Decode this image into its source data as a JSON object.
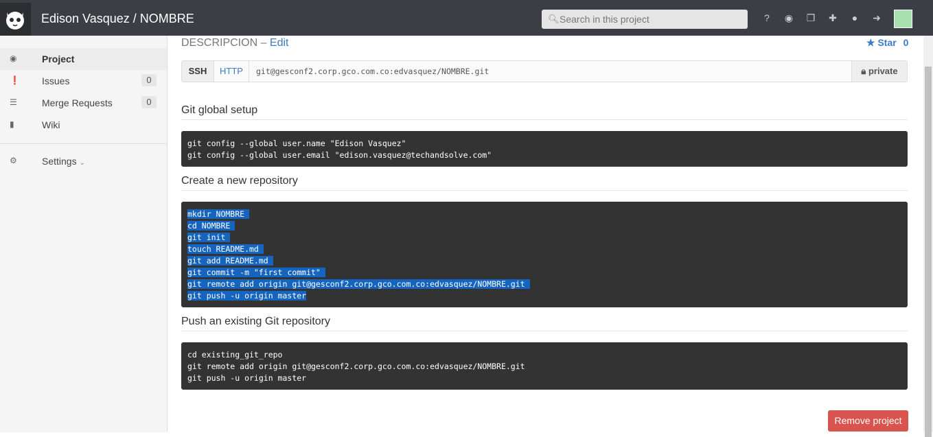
{
  "header": {
    "title": "Edison Vasquez / NOMBRE",
    "search_placeholder": "Search in this project"
  },
  "sidebar": {
    "items": [
      {
        "label": "Project",
        "icon": "dashboard-icon"
      },
      {
        "label": "Issues",
        "icon": "exclamation-circle-icon",
        "count": "0"
      },
      {
        "label": "Merge Requests",
        "icon": "list-icon",
        "count": "0"
      },
      {
        "label": "Wiki",
        "icon": "book-icon"
      },
      {
        "label": "Settings",
        "icon": "cogs-icon"
      }
    ]
  },
  "main": {
    "description": "DESCRIPCION – ",
    "edit_link": "Edit",
    "star_label": "Star",
    "star_count": "0",
    "clone": {
      "ssh": "SSH",
      "http": "HTTP",
      "url": "git@gesconf2.corp.gco.com.co:edvasquez/NOMBRE.git",
      "visibility": "private"
    },
    "sections": [
      {
        "title": "Git global setup",
        "lines": [
          "git config --global user.name \"Edison Vasquez\"",
          "git config --global user.email \"edison.vasquez@techandsolve.com\""
        ]
      },
      {
        "title": "Create a new repository",
        "lines": [
          "mkdir NOMBRE ",
          "cd NOMBRE ",
          "git init ",
          "touch README.md ",
          "git add README.md ",
          "git commit -m \"first commit\" ",
          "git remote add origin git@gesconf2.corp.gco.com.co:edvasquez/NOMBRE.git ",
          "git push -u origin master"
        ]
      },
      {
        "title": "Push an existing Git repository",
        "lines": [
          "cd existing_git_repo",
          "git remote add origin git@gesconf2.corp.gco.com.co:edvasquez/NOMBRE.git",
          "git push -u origin master"
        ]
      }
    ],
    "remove_label": "Remove project"
  }
}
